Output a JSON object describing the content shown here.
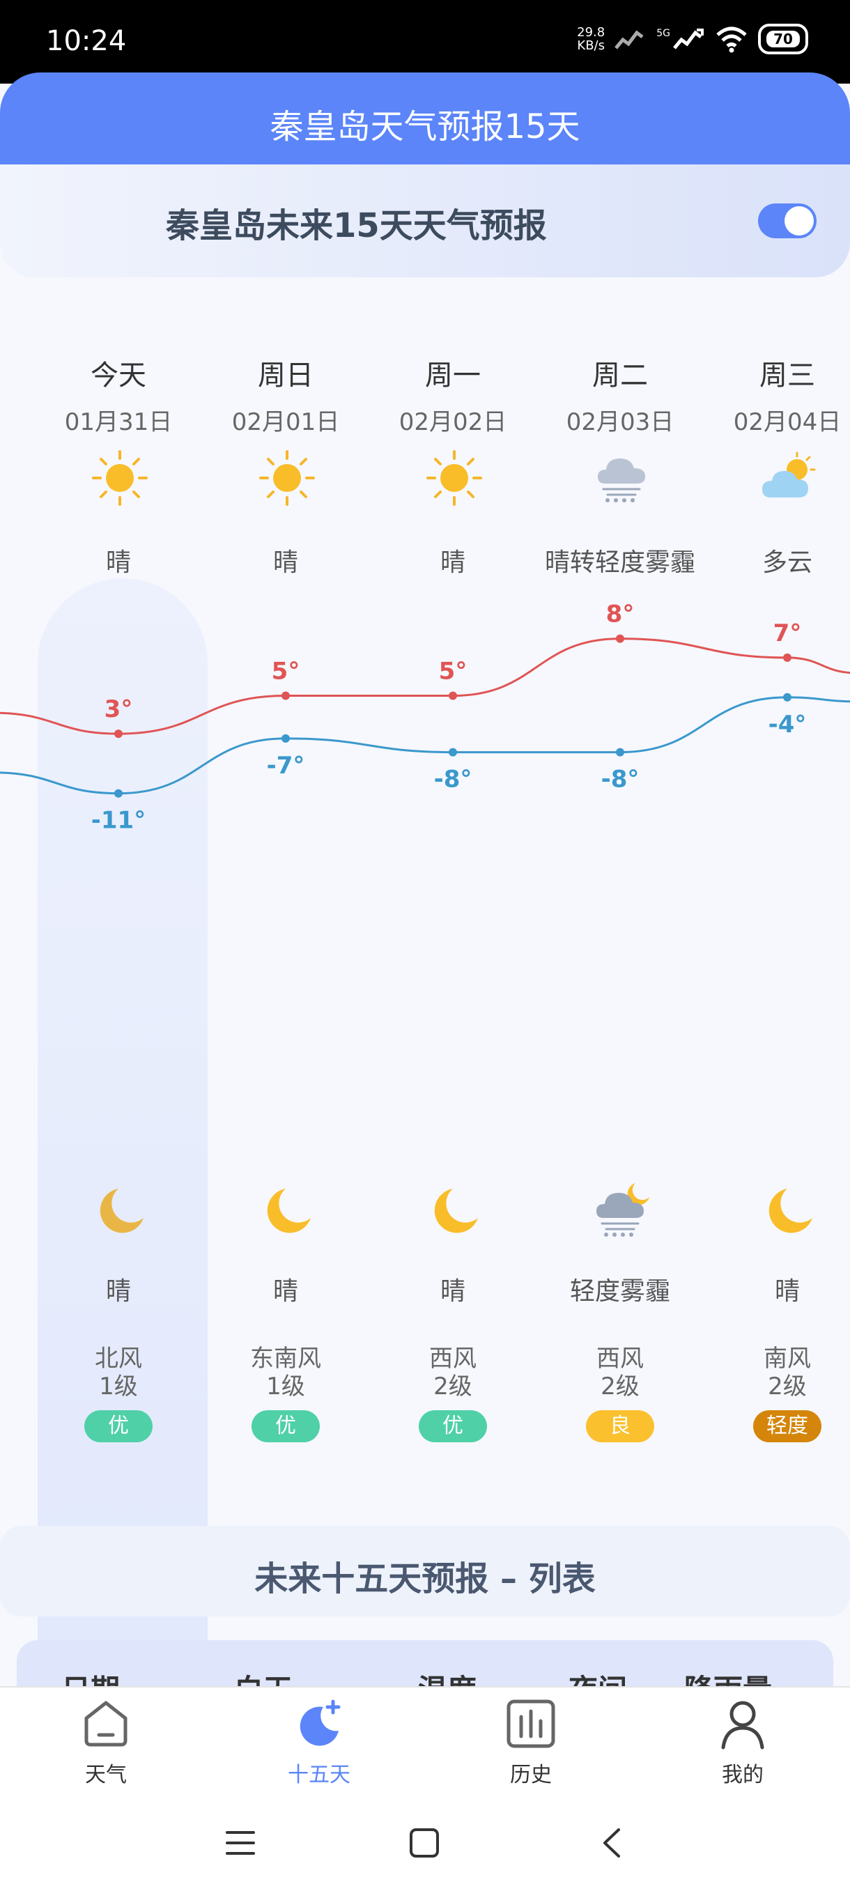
{
  "status_bar": {
    "time": "10:24",
    "net_speed_value": "29.8",
    "net_speed_unit": "KB/s",
    "network": "5G",
    "battery": "70"
  },
  "header": {
    "title": "秦皇岛天气预报15天"
  },
  "section": {
    "subtitle": "秦皇岛未来15天天气预报",
    "toggle_on": true
  },
  "forecast": [
    {
      "day": "今天",
      "date": "01月31日",
      "day_icon": "sun-icon",
      "day_weather": "晴",
      "high": "3°",
      "low": "-11°",
      "night_icon": "moon-icon",
      "night_weather": "晴",
      "wind_dir": "北风",
      "wind_level": "1级",
      "aqi": "优",
      "aqi_color": "#4fd0a7"
    },
    {
      "day": "周日",
      "date": "02月01日",
      "day_icon": "sun-icon",
      "day_weather": "晴",
      "high": "5°",
      "low": "-7°",
      "night_icon": "moon-icon",
      "night_weather": "晴",
      "wind_dir": "东南风",
      "wind_level": "1级",
      "aqi": "优",
      "aqi_color": "#4fd0a7"
    },
    {
      "day": "周一",
      "date": "02月02日",
      "day_icon": "sun-icon",
      "day_weather": "晴",
      "high": "5°",
      "low": "-8°",
      "night_icon": "moon-icon",
      "night_weather": "晴",
      "wind_dir": "西风",
      "wind_level": "2级",
      "aqi": "优",
      "aqi_color": "#4fd0a7"
    },
    {
      "day": "周二",
      "date": "02月03日",
      "day_icon": "haze-cloud-icon",
      "day_weather": "晴转轻度雾霾",
      "high": "8°",
      "low": "-8°",
      "night_icon": "haze-cloud-moon-icon",
      "night_weather": "轻度雾霾",
      "wind_dir": "西风",
      "wind_level": "2级",
      "aqi": "良",
      "aqi_color": "#fbc02d"
    },
    {
      "day": "周三",
      "date": "02月04日",
      "day_icon": "partly-cloudy-icon",
      "day_weather": "多云",
      "high": "7°",
      "low": "-4°",
      "night_icon": "moon-icon",
      "night_weather": "晴",
      "wind_dir": "南风",
      "wind_level": "2级",
      "aqi": "轻度",
      "aqi_color": "#d4850a"
    }
  ],
  "chart_data": {
    "type": "line",
    "categories": [
      "01月31日",
      "02月01日",
      "02月02日",
      "02月03日",
      "02月04日"
    ],
    "series": [
      {
        "values": [
          3,
          5,
          5,
          8,
          7
        ],
        "color": "#e05454"
      },
      {
        "values": [
          -11,
          -7,
          -8,
          -8,
          -4
        ],
        "color": "#3a98cc"
      }
    ]
  },
  "list": {
    "title": "未来十五天预报 – 列表",
    "columns": [
      "日期",
      "白天",
      "温度",
      "夜间",
      "降雨量"
    ]
  },
  "bottom_nav": [
    {
      "label": "天气",
      "icon": "house-icon",
      "active": false
    },
    {
      "label": "十五天",
      "icon": "moon-star-icon",
      "active": true
    },
    {
      "label": "历史",
      "icon": "bar-chart-icon",
      "active": false
    },
    {
      "label": "我的",
      "icon": "person-icon",
      "active": false
    }
  ],
  "colors": {
    "accent": "#5b85f9",
    "high_line": "#e05454",
    "low_line": "#3a98cc",
    "nav_active": "#5b85f9"
  }
}
